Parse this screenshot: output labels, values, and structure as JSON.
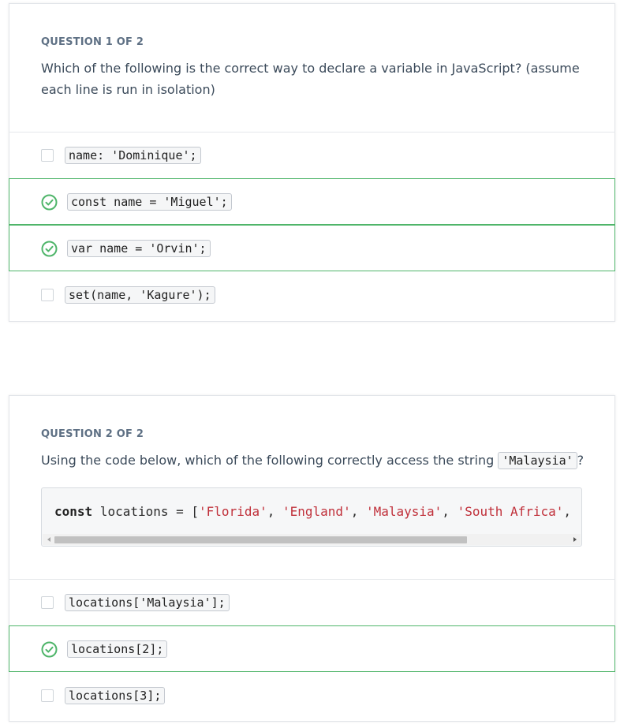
{
  "colors": {
    "correct": "#4fb56a",
    "string": "#c0303a",
    "heading": "#5e7084"
  },
  "questions": [
    {
      "number_label": "QUESTION 1 OF 2",
      "prompt": "Which of the following is the correct way to declare a variable in JavaScript? (assume each line is run in isolation)",
      "answers": [
        {
          "code": "name: 'Dominique';",
          "correct": false,
          "icon": "checkbox-empty-icon"
        },
        {
          "code": "const name = 'Miguel';",
          "correct": true,
          "icon": "check-circle-icon"
        },
        {
          "code": "var name = 'Orvin';",
          "correct": true,
          "icon": "check-circle-icon"
        },
        {
          "code": "set(name, 'Kagure');",
          "correct": false,
          "icon": "checkbox-empty-icon"
        }
      ]
    },
    {
      "number_label": "QUESTION 2 OF 2",
      "prompt_before": "Using the code below, which of the following correctly access the string ",
      "prompt_code": "'Malaysia'",
      "prompt_after": "?",
      "code": {
        "keyword": "const",
        "identifier": " locations = [",
        "strings": [
          "'Florida'",
          "'England'",
          "'Malaysia'",
          "'South Africa'",
          "'"
        ],
        "separator": ", "
      },
      "answers": [
        {
          "code": "locations['Malaysia'];",
          "correct": false,
          "icon": "checkbox-empty-icon"
        },
        {
          "code": "locations[2];",
          "correct": true,
          "icon": "check-circle-icon"
        },
        {
          "code": "locations[3];",
          "correct": false,
          "icon": "checkbox-empty-icon"
        }
      ]
    }
  ]
}
